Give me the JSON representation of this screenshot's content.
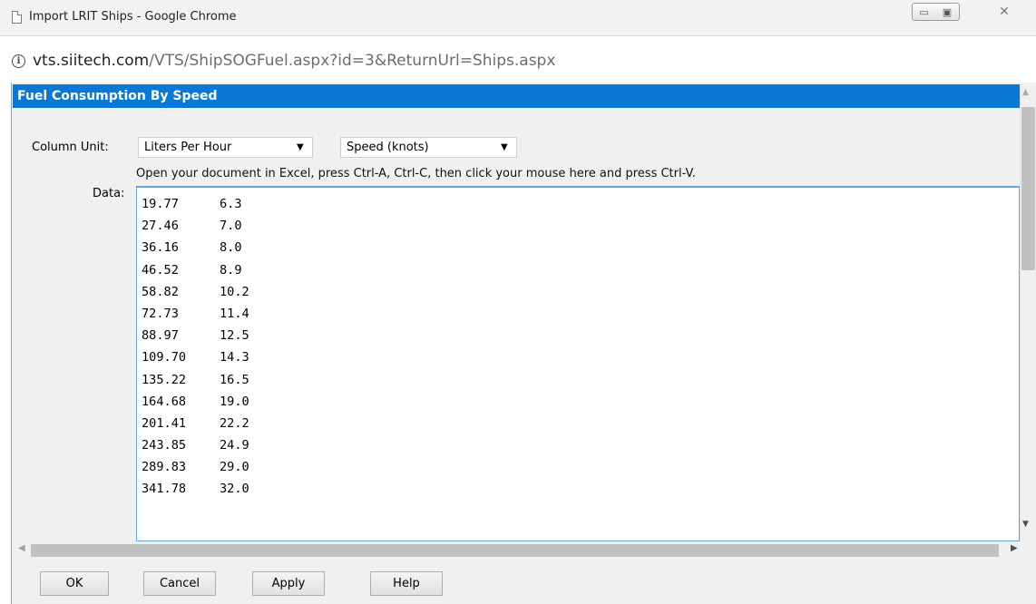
{
  "window": {
    "title": "Import LRIT Ships - Google Chrome",
    "minimize_glyph": "▭",
    "maximize_glyph": "▣",
    "close_glyph": "✕"
  },
  "address_bar": {
    "info_glyph": "i",
    "url_host": "vts.siitech.com",
    "url_path": "/VTS/ShipSOGFuel.aspx?id=3&ReturnUrl=Ships.aspx"
  },
  "panel": {
    "title": "Fuel Consumption By Speed"
  },
  "form": {
    "column_unit_label": "Column Unit:",
    "unit_select": {
      "selected": "Liters Per Hour"
    },
    "speed_select": {
      "selected": "Speed (knots)"
    },
    "instructions": "Open your document in Excel, press Ctrl-A, Ctrl-C, then click your mouse here and press Ctrl-V.",
    "data_label": "Data:",
    "data_rows": [
      [
        "19.77",
        "6.3"
      ],
      [
        "27.46",
        "7.0"
      ],
      [
        "36.16",
        "8.0"
      ],
      [
        "46.52",
        "8.9"
      ],
      [
        "58.82",
        "10.2"
      ],
      [
        "72.73",
        "11.4"
      ],
      [
        "88.97",
        "12.5"
      ],
      [
        "109.70",
        "14.3"
      ],
      [
        "135.22",
        "16.5"
      ],
      [
        "164.68",
        "19.0"
      ],
      [
        "201.41",
        "22.2"
      ],
      [
        "243.85",
        "24.9"
      ],
      [
        "289.83",
        "29.0"
      ],
      [
        "341.78",
        "32.0"
      ]
    ]
  },
  "buttons": {
    "ok": "OK",
    "cancel": "Cancel",
    "apply": "Apply",
    "help": "Help"
  },
  "icons": {
    "dropdown_arrow": "▼",
    "scroll_up": "▲",
    "scroll_down": "▼",
    "scroll_left": "◀",
    "scroll_right": "▶"
  }
}
